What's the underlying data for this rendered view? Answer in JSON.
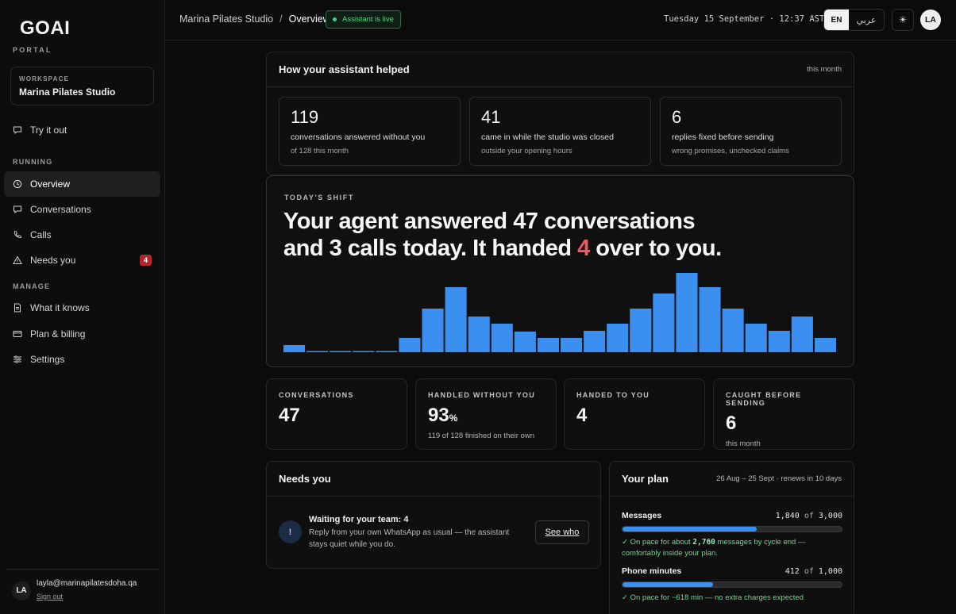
{
  "brand": {
    "logo": "GOAI",
    "portal": "PORTAL"
  },
  "workspace": {
    "label": "WORKSPACE",
    "name": "Marina Pilates Studio"
  },
  "sidebar": {
    "try_it_out": "Try it out",
    "running_label": "RUNNING",
    "running": [
      {
        "label": "Overview",
        "icon": "clock-icon"
      },
      {
        "label": "Conversations",
        "icon": "chat-icon"
      },
      {
        "label": "Calls",
        "icon": "phone-icon"
      },
      {
        "label": "Needs you",
        "icon": "warning-icon",
        "badge": "4"
      }
    ],
    "manage_label": "MANAGE",
    "manage": [
      {
        "label": "What it knows",
        "icon": "document-icon"
      },
      {
        "label": "Plan & billing",
        "icon": "card-icon"
      },
      {
        "label": "Settings",
        "icon": "sliders-icon"
      }
    ]
  },
  "user": {
    "initials": "LA",
    "email": "layla@marinapilatesdoha.qa",
    "sign_out": "Sign out"
  },
  "header": {
    "breadcrumb_root": "Marina Pilates Studio",
    "breadcrumb_sep": "/",
    "breadcrumb_current": "Overview",
    "status": "Assistant is live",
    "datetime": "Tuesday 15 September · 12:37 AST",
    "lang_en": "EN",
    "lang_ar": "عربي",
    "theme_icon": "☀",
    "avatar": "LA"
  },
  "helped": {
    "title": "How your assistant helped",
    "period": "this month",
    "stats": [
      {
        "num": "119",
        "main": "conversations answered without you",
        "sub": "of 128 this month"
      },
      {
        "num": "41",
        "main": "came in while the studio was closed",
        "sub": "outside your opening hours"
      },
      {
        "num": "6",
        "main": "replies fixed before sending",
        "sub": "wrong promises, unchecked claims"
      }
    ]
  },
  "shift": {
    "label": "TODAY'S SHIFT",
    "line1": "Your agent answered 47 conversations",
    "line2_a": "and 3 calls today. It handed ",
    "line2_num": "4",
    "line2_b": " over to you.",
    "bar_color": "#3a8ff0"
  },
  "chart_data": {
    "type": "bar",
    "values": [
      0.09,
      0.01,
      0.01,
      0.01,
      0.01,
      0.18,
      0.55,
      0.82,
      0.45,
      0.36,
      0.26,
      0.18,
      0.18,
      0.27,
      0.36,
      0.55,
      0.74,
      1.0,
      0.82,
      0.55,
      0.36,
      0.27,
      0.45,
      0.18
    ],
    "ylim": [
      0,
      1
    ]
  },
  "metrics": [
    {
      "label": "CONVERSATIONS",
      "value": "47",
      "suffix": "",
      "sub": ""
    },
    {
      "label": "HANDLED WITHOUT YOU",
      "value": "93",
      "suffix": "%",
      "sub": "119 of 128 finished on their own"
    },
    {
      "label": "HANDED TO YOU",
      "value": "4",
      "suffix": "",
      "sub": ""
    },
    {
      "label": "CAUGHT BEFORE SENDING",
      "value": "6",
      "suffix": "",
      "sub": "this month"
    }
  ],
  "needs": {
    "title": "Needs you",
    "icon": "!",
    "item_title": "Waiting for your team: 4",
    "item_body": "Reply from your own WhatsApp as usual — the assistant stays quiet while you do.",
    "button": "See who"
  },
  "plan": {
    "title": "Your plan",
    "period": "26 Aug – 25 Sept · renews in 10 days",
    "rows": [
      {
        "name": "Messages",
        "used": "1,840",
        "of": " of ",
        "total": "3,000",
        "fraction": 0.613,
        "note_a": "✓ On pace for about ",
        "note_num": "2,760",
        "note_b": " messages by cycle end — comfortably inside your plan."
      },
      {
        "name": "Phone minutes",
        "used": "412",
        "of": " of ",
        "total": "1,000",
        "fraction": 0.412,
        "note_a": "✓ On pace for ~618 min — no extra charges expected",
        "note_num": "",
        "note_b": ""
      }
    ]
  }
}
